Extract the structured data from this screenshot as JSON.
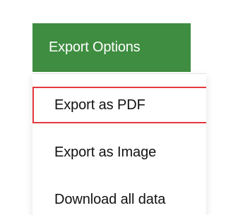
{
  "export_button": {
    "label": "Export Options"
  },
  "menu": {
    "items": [
      {
        "label": "Export as PDF",
        "highlighted": true
      },
      {
        "label": "Export as Image",
        "highlighted": false
      },
      {
        "label": "Download all data",
        "highlighted": false
      }
    ]
  },
  "colors": {
    "button_background": "#3e8d40",
    "button_text": "#ffffff",
    "highlight_border": "#e5373e",
    "menu_text": "#111111",
    "divider": "#e4e4e4"
  }
}
